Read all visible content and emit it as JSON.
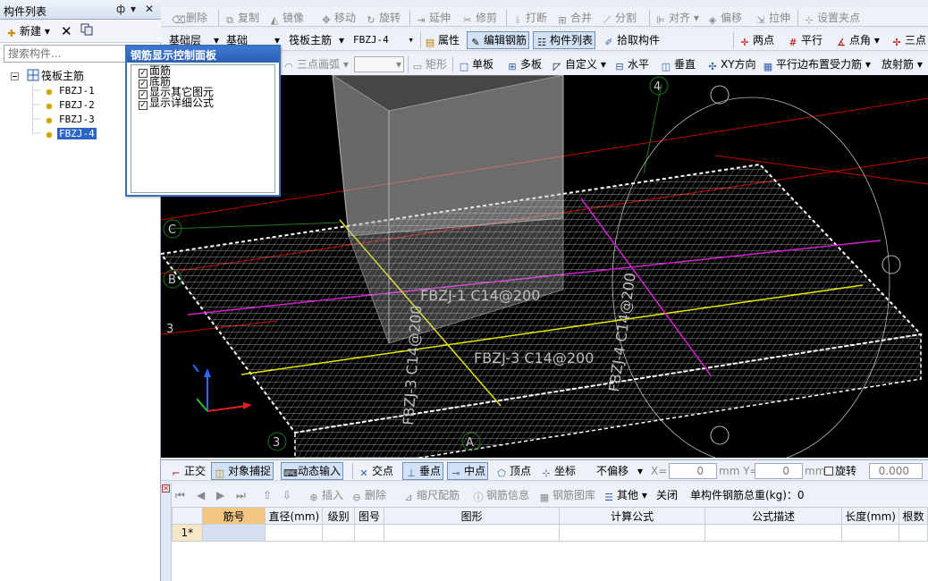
{
  "left_panel": {
    "title": "构件列表",
    "pin_symbol": "ф",
    "dropdown_symbol": "▾",
    "close_symbol": "✕",
    "new_label": "新建",
    "search_placeholder": "搜索构件...",
    "tree": {
      "root_label": "筏板主筋",
      "items": [
        "FBZJ-1",
        "FBZJ-2",
        "FBZJ-3",
        "FBZJ-4"
      ],
      "selected": "FBZJ-4"
    }
  },
  "toolbar1": {
    "delete": "删除",
    "copy": "复制",
    "mirror": "镜像",
    "move": "移动",
    "rotate": "旋转",
    "extend": "延伸",
    "trim": "修剪",
    "break": "打断",
    "merge": "合并",
    "split": "分割",
    "align": "对齐",
    "offset": "偏移",
    "stretch": "拉伸",
    "set_grip": "设置夹点"
  },
  "toolbar2": {
    "layer": "基础层",
    "category": "基础",
    "type": "筏板主筋",
    "component": "FBZJ-4",
    "properties": "属性",
    "edit_rebar": "编辑钢筋",
    "component_list": "构件列表",
    "pick_component": "拾取构件",
    "two_points": "两点",
    "parallel": "平行",
    "point_angle": "点角",
    "three_points": "三点"
  },
  "toolbar3": {
    "three_point_arc": "三点画弧",
    "rect": "矩形",
    "single_slab": "单板",
    "multi_slab": "多板",
    "custom": "自定义",
    "horizontal": "水平",
    "vertical": "垂直",
    "xy_direction": "XY方向",
    "parallel_edge": "平行边布置受力筋",
    "radial": "放射筋"
  },
  "rebar_panel": {
    "title": "钢筋显示控制面板",
    "options": [
      {
        "label": "面筋",
        "checked": true
      },
      {
        "label": "底筋",
        "checked": true
      },
      {
        "label": "显示其它图元",
        "checked": true
      },
      {
        "label": "显示详细公式",
        "checked": true
      }
    ]
  },
  "viewport": {
    "labels": {
      "axis_4": "4",
      "axis_C": "C",
      "axis_B": "B",
      "axis_3_left": "3",
      "axis_3_bottom": "3",
      "axis_A": "A",
      "fbzj1": "FBZJ-1 C14@200",
      "fbzj3_horizontal": "FBZJ-3 C14@200",
      "fbzj3_vertical": "FBZJ-3 C14@200",
      "fbzj4": "FBZJ-4 C14@200"
    }
  },
  "snapbar": {
    "ortho": "正交",
    "object_snap": "对象捕捉",
    "dynamic_input": "动态输入",
    "intersection": "交点",
    "perpendicular": "垂点",
    "midpoint": "中点",
    "vertex": "顶点",
    "coordinate": "坐标",
    "offset_mode": "不偏移",
    "x_label": "X=",
    "x_value": "0",
    "y_label": "mm Y=",
    "y_value": "0",
    "mm_label": "mm",
    "rotate_label": "旋转",
    "rotate_value": "0.000"
  },
  "table_toolbar": {
    "insert": "插入",
    "delete": "删除",
    "scale_rebar": "缩尺配筋",
    "rebar_info": "钢筋信息",
    "rebar_library": "钢筋图库",
    "other": "其他",
    "close": "关闭",
    "total_weight": "单构件钢筋总重(kg)：0"
  },
  "rebar_table": {
    "columns": [
      "筋号",
      "直径(mm)",
      "级别",
      "图号",
      "图形",
      "计算公式",
      "公式描述",
      "长度(mm)",
      "根数"
    ],
    "rows": [
      {
        "row_label": "1*",
        "cells": [
          "",
          "",
          "",
          "",
          "",
          "",
          "",
          "",
          ""
        ]
      }
    ]
  }
}
